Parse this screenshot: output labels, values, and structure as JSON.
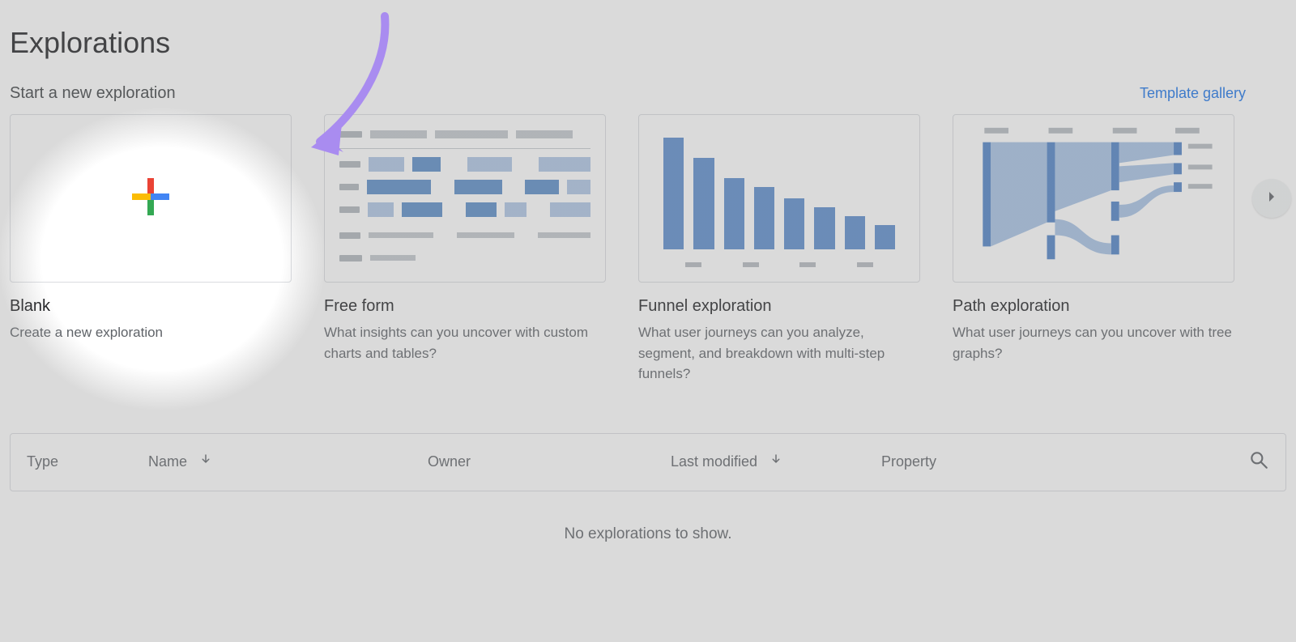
{
  "header": {
    "title": "Explorations"
  },
  "start_section": {
    "subtitle": "Start a new exploration",
    "template_gallery_label": "Template gallery"
  },
  "cards": [
    {
      "title": "Blank",
      "description": "Create a new exploration"
    },
    {
      "title": "Free form",
      "description": "What insights can you uncover with custom charts and tables?"
    },
    {
      "title": "Funnel exploration",
      "description": "What user journeys can you analyze, segment, and breakdown with multi-step funnels?"
    },
    {
      "title": "Path exploration",
      "description": "What user journeys can you uncover with tree graphs?"
    }
  ],
  "table": {
    "columns": {
      "type": "Type",
      "name": "Name",
      "owner": "Owner",
      "last_modified": "Last modified",
      "property": "Property"
    },
    "empty_message": "No explorations to show."
  },
  "annotation": {
    "arrow_color": "#a98cf0"
  }
}
